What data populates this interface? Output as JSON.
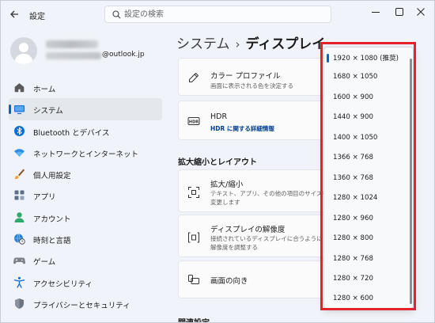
{
  "titlebar": {
    "title": "設定",
    "search_placeholder": "設定の検索"
  },
  "profile": {
    "email_suffix": "@outlook.jp"
  },
  "sidebar": {
    "items": [
      {
        "label": "ホーム",
        "icon": "home-icon"
      },
      {
        "label": "システム",
        "icon": "monitor-icon",
        "active": true
      },
      {
        "label": "Bluetooth とデバイス",
        "icon": "bluetooth-icon"
      },
      {
        "label": "ネットワークとインターネット",
        "icon": "wifi-icon"
      },
      {
        "label": "個人用設定",
        "icon": "paintbrush-icon"
      },
      {
        "label": "アプリ",
        "icon": "apps-icon"
      },
      {
        "label": "アカウント",
        "icon": "account-icon"
      },
      {
        "label": "時刻と言語",
        "icon": "globe-clock-icon"
      },
      {
        "label": "ゲーム",
        "icon": "gamepad-icon"
      },
      {
        "label": "アクセシビリティ",
        "icon": "accessibility-icon"
      },
      {
        "label": "プライバシーとセキュリティ",
        "icon": "shield-icon"
      }
    ]
  },
  "breadcrumb": {
    "root": "システム",
    "separator": "›",
    "current": "ディスプレイ"
  },
  "cards": {
    "color_profile": {
      "title": "カラー プロファイル",
      "subtitle": "画面に表示される色を決定する",
      "icon": "eyedropper-icon"
    },
    "hdr": {
      "title": "HDR",
      "link": "HDR に関する詳細情報",
      "icon": "hdr-icon"
    },
    "scale": {
      "title": "拡大/縮小",
      "subtitle1": "テキスト、アプリ、その他の項目のサイズを",
      "subtitle2": "変更します",
      "icon": "resize-icon"
    },
    "resolution": {
      "title": "ディスプレイの解像度",
      "subtitle1": "接続されているディスプレイに合うように",
      "subtitle2": "解像度を調整する",
      "icon": "resolution-icon"
    },
    "orientation": {
      "title": "画面の向き",
      "icon": "rotate-screen-icon"
    }
  },
  "sections": {
    "scale_layout": "拡大縮小とレイアウト",
    "related": "関連設定"
  },
  "resolution_dropdown": {
    "options": [
      "1920 × 1080 (推奨)",
      "1680 × 1050",
      "1600 × 900",
      "1440 × 900",
      "1400 × 1050",
      "1366 × 768",
      "1360 × 768",
      "1280 × 1024",
      "1280 × 960",
      "1280 × 800",
      "1280 × 768",
      "1280 × 720",
      "1280 × 600"
    ],
    "selected_index": 0
  },
  "colors": {
    "accent": "#0067c0",
    "highlight_border": "#e3222b",
    "link": "#003e92"
  }
}
